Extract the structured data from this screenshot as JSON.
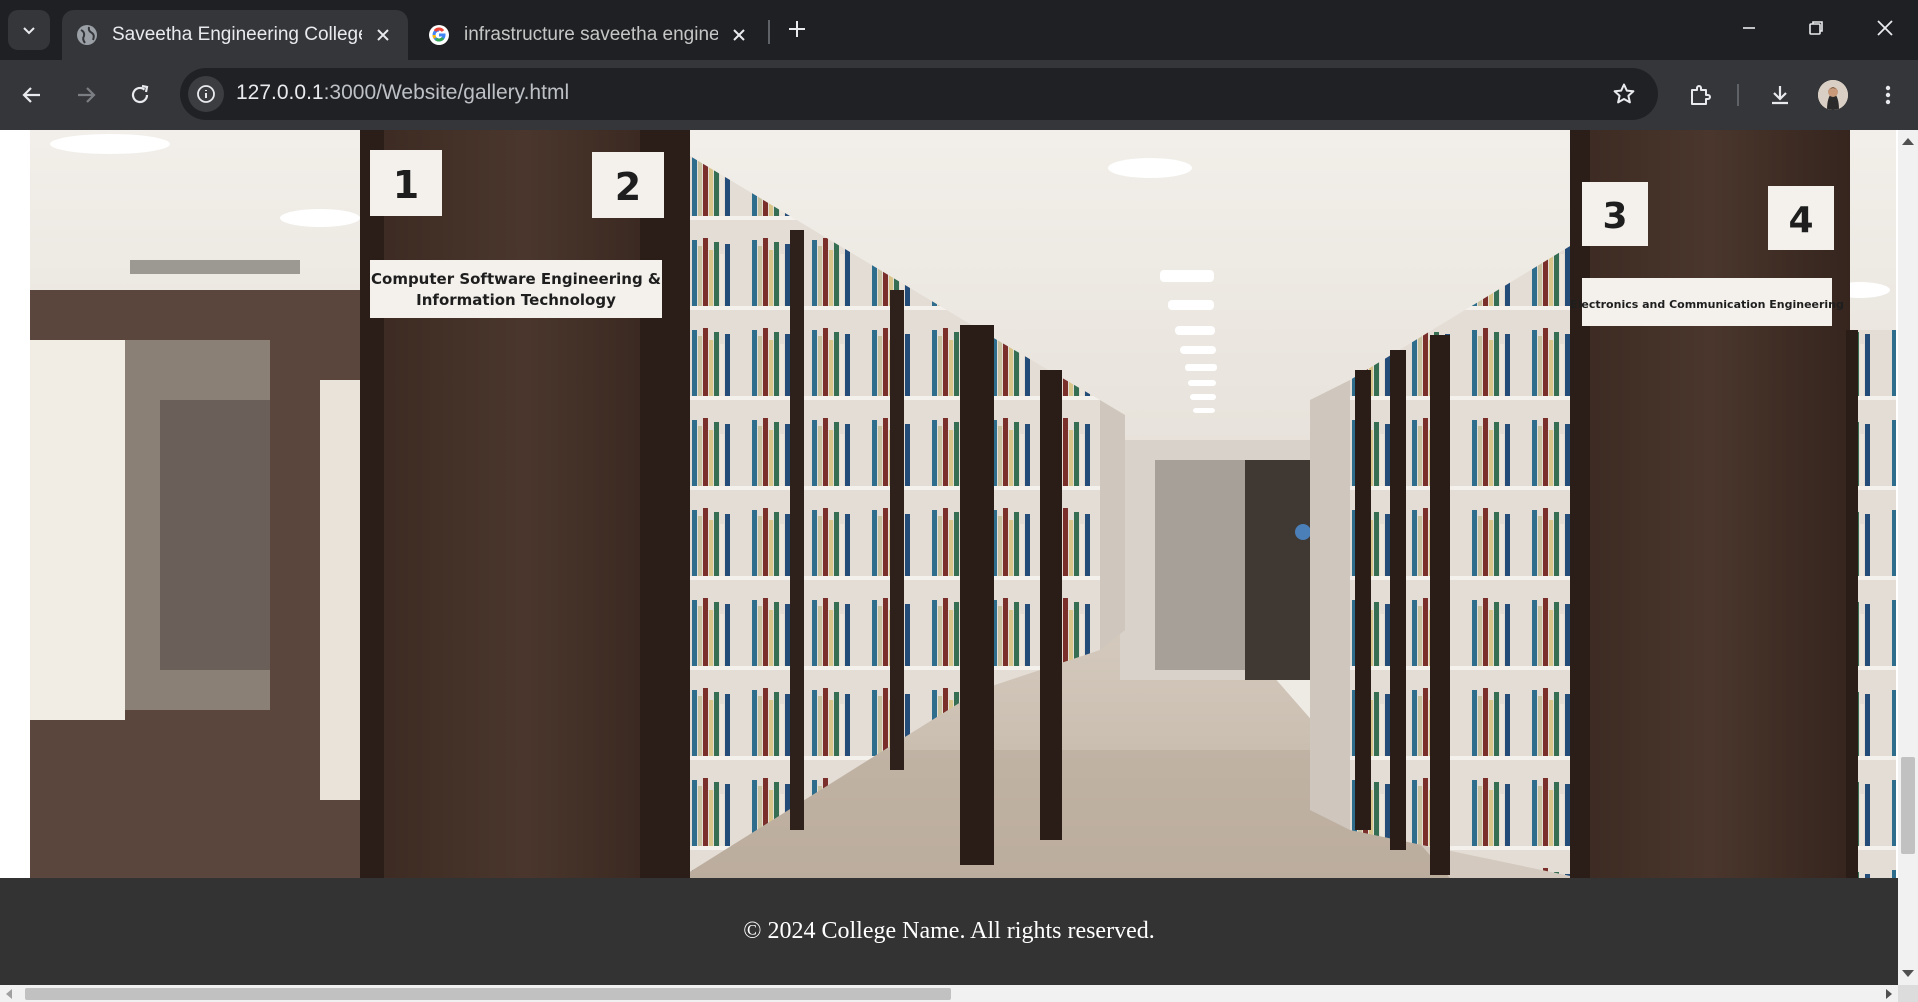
{
  "browser": {
    "tabs": [
      {
        "title": "Saveetha Engineering College",
        "active": true,
        "favicon": "globe-icon"
      },
      {
        "title": "infrastructure saveetha enginee",
        "active": false,
        "favicon": "google-icon"
      }
    ],
    "url": {
      "host": "127.0.0.1",
      "path": ":3000/Website/gallery.html"
    },
    "colors": {
      "chrome_dark": "#1f2023",
      "toolbar": "#35363a",
      "omnibox": "#202124",
      "text": "#e8eaed"
    }
  },
  "gallery": {
    "image": {
      "subject": "library-aisle-photo",
      "bay_numbers": [
        "1",
        "2",
        "3",
        "4"
      ],
      "sign_left": [
        "Computer Software Engineering &",
        "Information Technology"
      ],
      "sign_right": "Electronics and Communication Engineering"
    }
  },
  "footer": {
    "text": "© 2024 College Name. All rights reserved.",
    "background": "#333333"
  }
}
